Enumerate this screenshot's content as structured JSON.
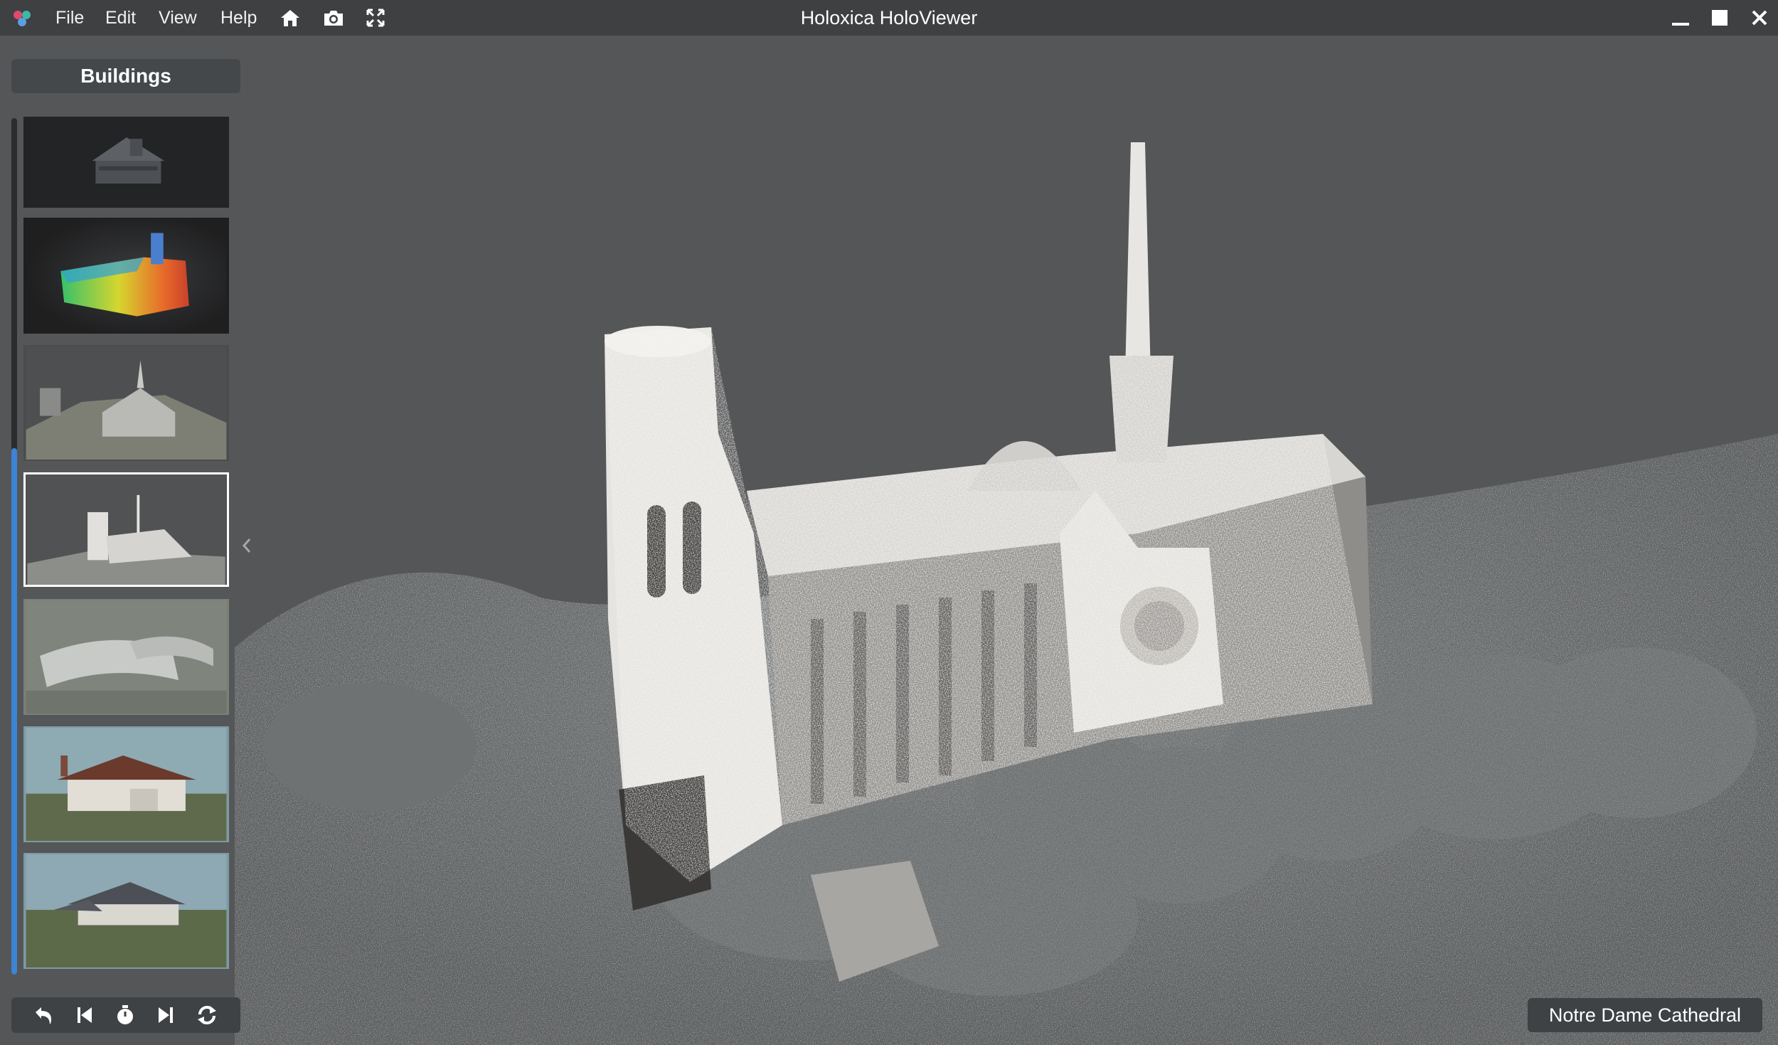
{
  "window": {
    "title": "Holoxica HoloViewer"
  },
  "menu": {
    "items": [
      "File",
      "Edit",
      "View",
      "Help"
    ]
  },
  "toolbar": {
    "icons": [
      "home-icon",
      "camera-icon",
      "fullscreen-icon"
    ]
  },
  "window_controls": [
    "minimize-icon",
    "maximize-icon",
    "close-icon"
  ],
  "sidebar": {
    "category": "Buildings",
    "thumbnails": [
      {
        "name": "victorian-house",
        "selected": false
      },
      {
        "name": "heatmap-church",
        "selected": false
      },
      {
        "name": "hillside-church",
        "selected": false
      },
      {
        "name": "notre-dame-aerial",
        "selected": true
      },
      {
        "name": "curved-office-building",
        "selected": false
      },
      {
        "name": "brick-house",
        "selected": false
      },
      {
        "name": "country-house",
        "selected": false
      }
    ],
    "scroll_position": 0.38
  },
  "controls": {
    "icons": [
      "undo-icon",
      "skip-back-icon",
      "timer-icon",
      "skip-forward-icon",
      "refresh-icon"
    ]
  },
  "viewer": {
    "model_name": "Notre Dame Cathedral"
  },
  "colors": {
    "titlebar": "#3e4042",
    "background": "#555657",
    "accent": "#3c84d6",
    "panel": "#3f4244"
  }
}
